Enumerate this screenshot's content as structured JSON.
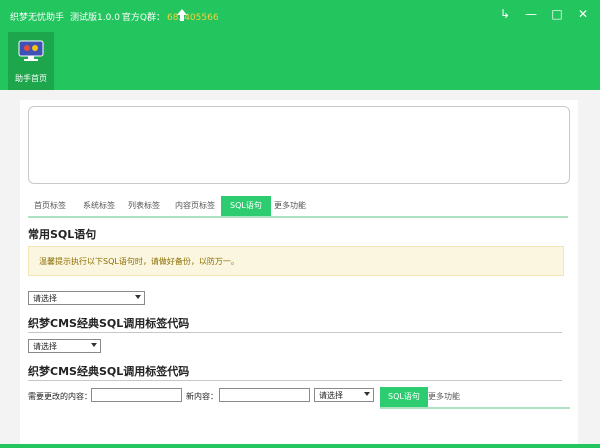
{
  "titlebar": {
    "app_name": "织梦无忧助手",
    "version": "测试版1.0.0",
    "qq_group_label": "官方Q群：",
    "qq_group_number": "682405566"
  },
  "window_buttons": [
    "↳",
    "—",
    "□",
    "✕"
  ],
  "nav": {
    "home_label": "助手首页"
  },
  "tabs": [
    "首页标签",
    "系统标签",
    "列表标签",
    "内容页标签",
    "SQL语句",
    "更多功能"
  ],
  "active_tab": "SQL语句",
  "section1": {
    "title": "常用SQL语句",
    "notice": "温馨提示执行以下SQL语句时，请做好备份，以防万一。",
    "select_value": "请选择"
  },
  "section2": {
    "title": "织梦CMS经典SQL调用标签代码",
    "select_value": "请选择"
  },
  "section3": {
    "title": "织梦CMS经典SQL调用标签代码",
    "change_label": "需要更改的内容：",
    "new_label": "新内容：",
    "select_value": "请选择"
  },
  "overlay_tabs": [
    "SQL语句",
    "更多功能"
  ],
  "colors": {
    "brand_green": "#22c55e",
    "tab_green": "#2ecc71",
    "qq_number": "#f4d03f"
  }
}
